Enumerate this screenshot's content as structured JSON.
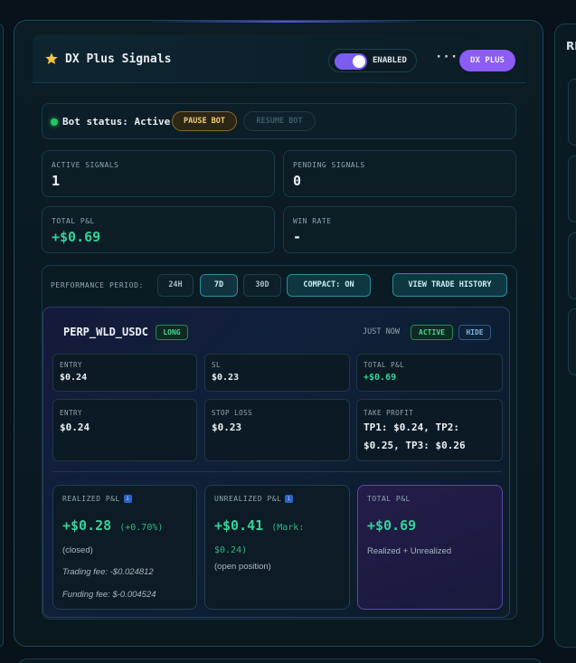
{
  "right_panel": {
    "title": "RE"
  },
  "header": {
    "title": "DX Plus Signals",
    "toggle_label": "ENABLED",
    "more_label": "···",
    "plan_badge": "DX PLUS"
  },
  "bot": {
    "status": "Bot status: Active",
    "pause_label": "PAUSE BOT",
    "resume_label": "RESUME BOT"
  },
  "stats": [
    {
      "label": "ACTIVE SIGNALS",
      "value": "1"
    },
    {
      "label": "PENDING SIGNALS",
      "value": "0"
    },
    {
      "label": "TOTAL P&L",
      "value": "+$0.69"
    },
    {
      "label": "WIN RATE",
      "value": "-"
    }
  ],
  "performance": {
    "label": "PERFORMANCE PERIOD:",
    "periods": [
      "24H",
      "7D",
      "30D"
    ],
    "selected": "7D",
    "compact_label": "COMPACT: ON",
    "history_label": "VIEW TRADE HISTORY"
  },
  "signal": {
    "symbol": "PERP_WLD_USDC",
    "side": "LONG",
    "time": "JUST NOW",
    "status": "ACTIVE",
    "hide_label": "HIDE",
    "compact": [
      {
        "label": "ENTRY",
        "value": "$0.24"
      },
      {
        "label": "SL",
        "value": "$0.23"
      },
      {
        "label": "TOTAL P&L",
        "value": "+$0.69"
      }
    ],
    "details": [
      {
        "label": "ENTRY",
        "value": "$0.24"
      },
      {
        "label": "STOP LOSS",
        "value": "$0.23"
      },
      {
        "label": "TAKE PROFIT",
        "value_line1": "TP1: $0.24, TP2:",
        "value_line2": "$0.25, TP3: $0.26"
      }
    ],
    "realized": {
      "label": "REALIZED P&L",
      "value": "+$0.28",
      "pct": "(+0.70%)",
      "note": "(closed)",
      "trading_fee": "Trading fee: -$0.024812",
      "funding_fee": "Funding fee: $-0.004524"
    },
    "unrealized": {
      "label": "UNREALIZED P&L",
      "value": "+$0.41",
      "mark_line1": "(Mark:",
      "mark_line2": "$0.24)",
      "note": "(open position)"
    },
    "total": {
      "label": "TOTAL P&L",
      "value": "+$0.69",
      "note": "Realized + Unrealized"
    }
  },
  "colors": {
    "accent_purple": "#8b5cf6",
    "profit_green": "#34d399",
    "cyan_border": "#2a8c9e",
    "warning_amber": "#f2cf78"
  }
}
